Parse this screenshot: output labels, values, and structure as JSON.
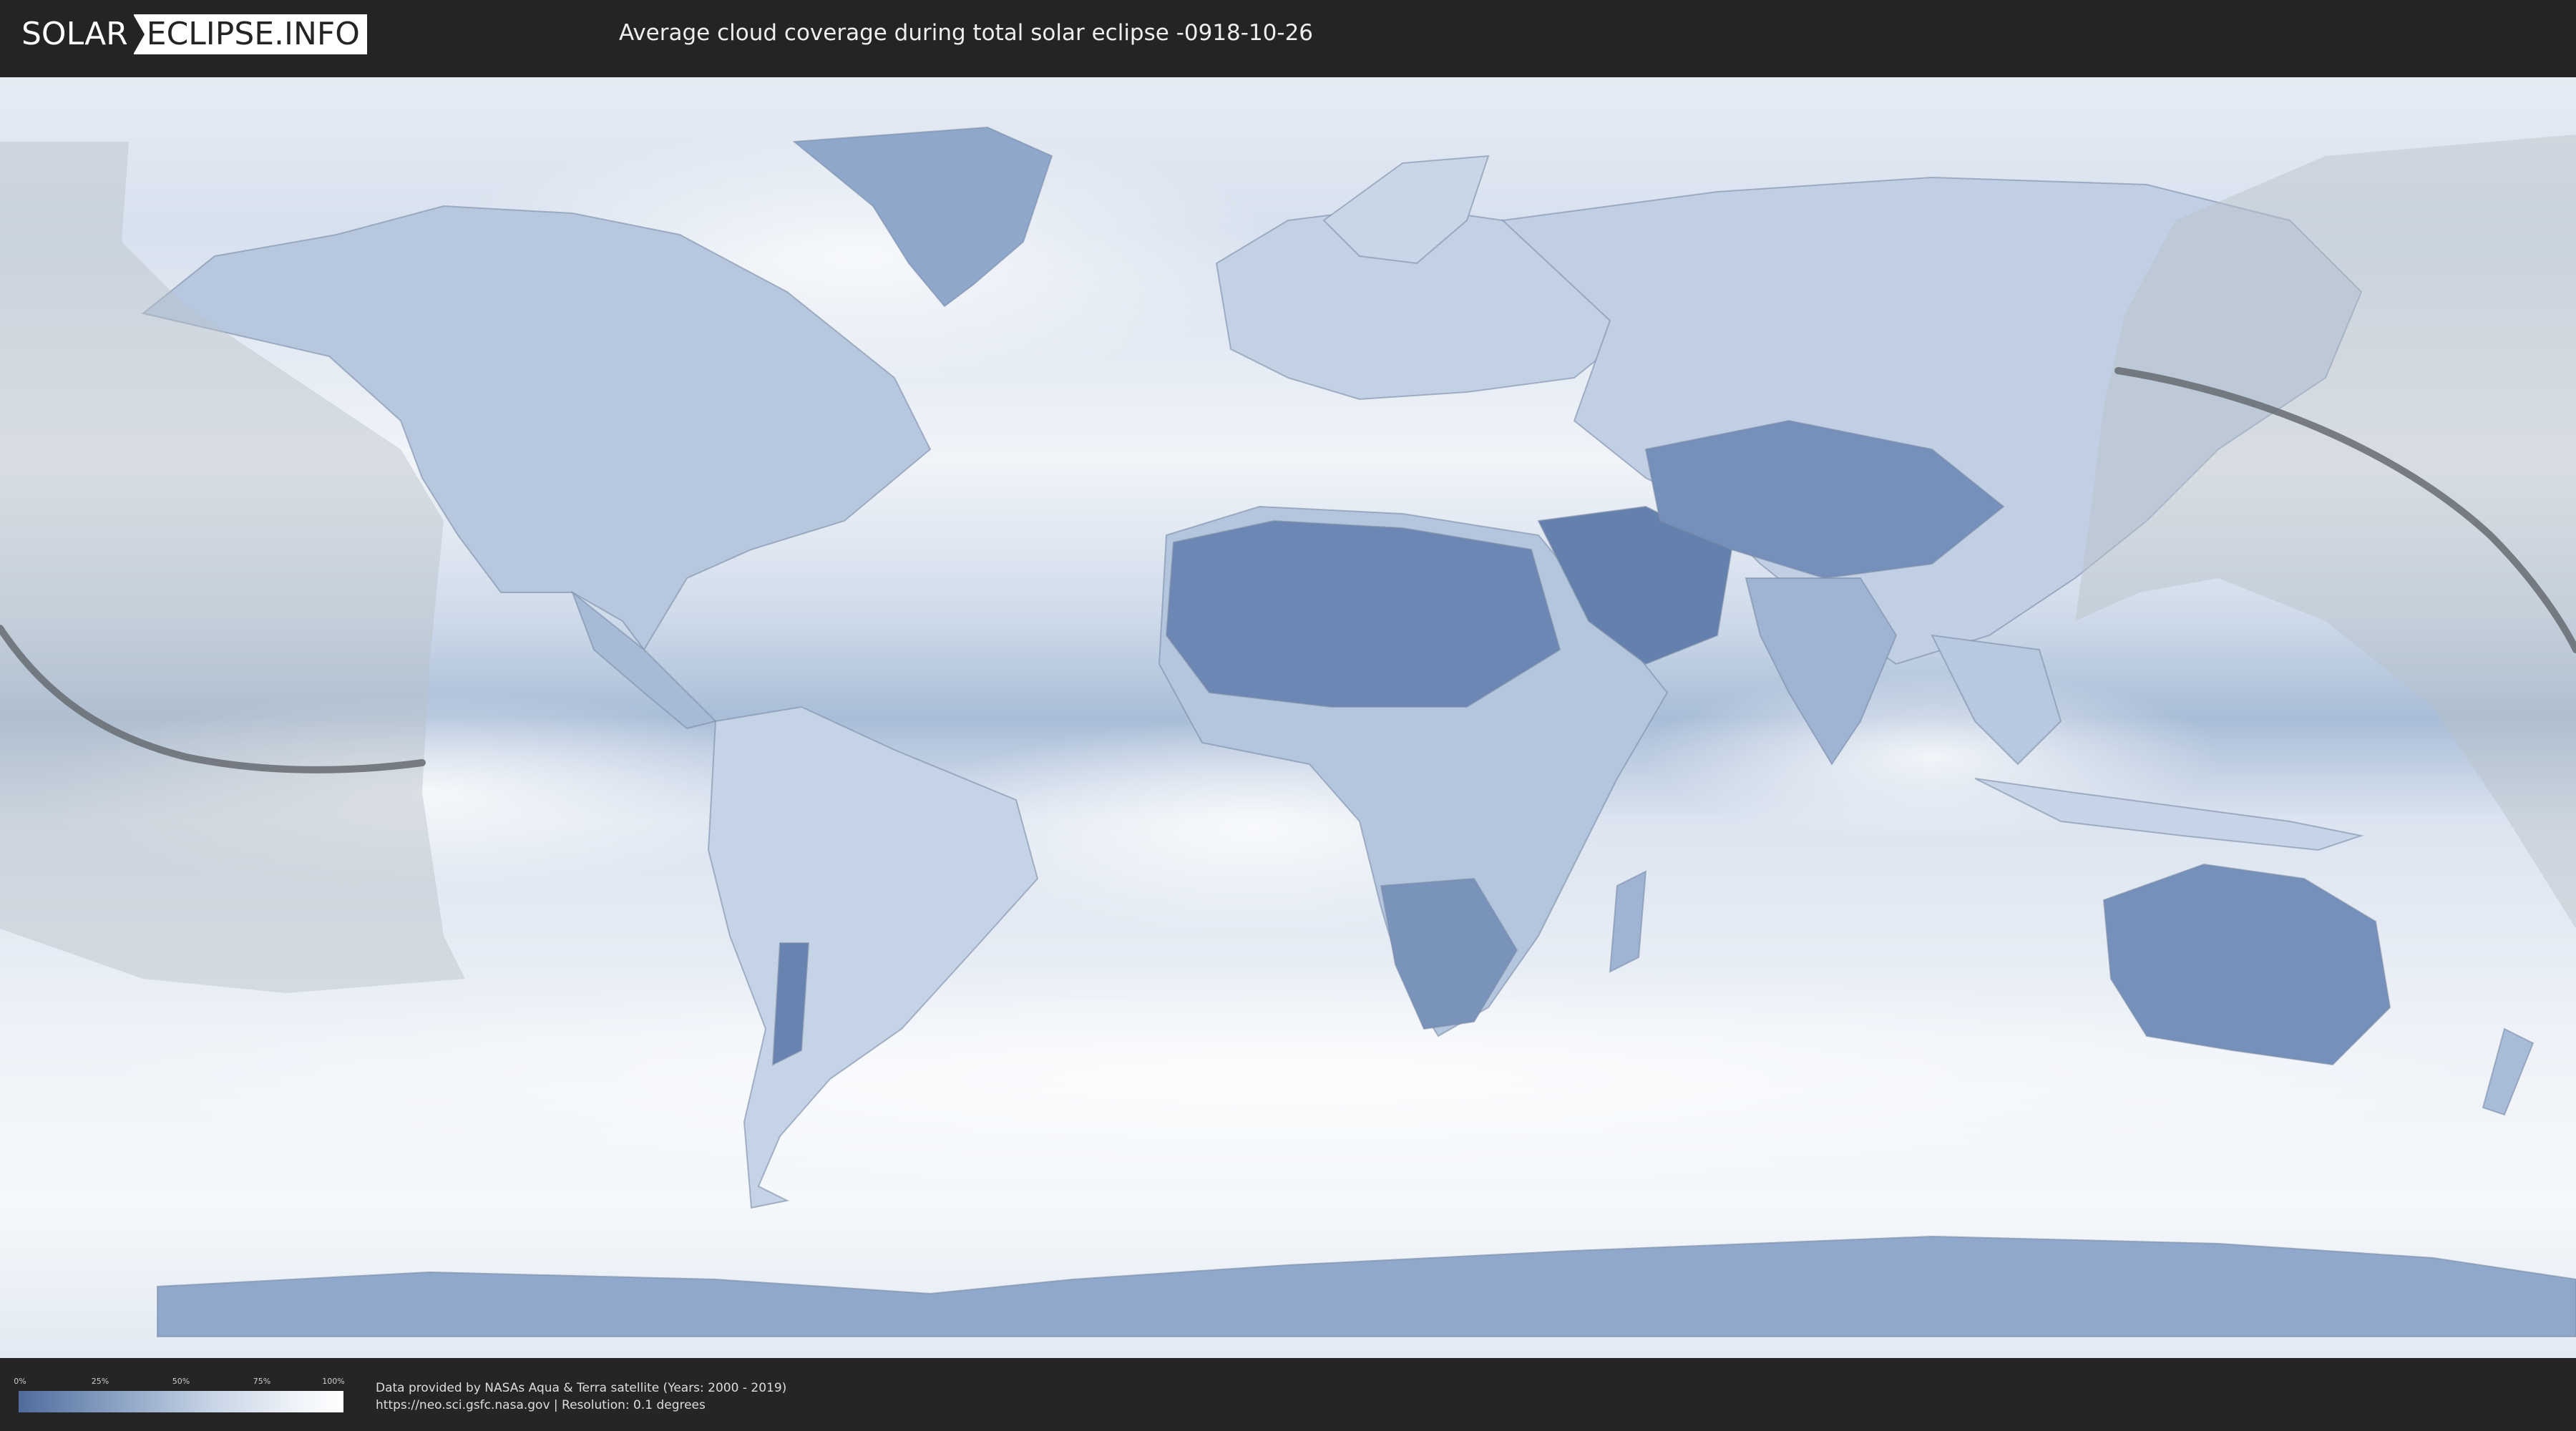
{
  "header": {
    "logo_left": "SOLAR",
    "logo_right": "ECLIPSE.INFO",
    "title": "Average cloud coverage during total solar eclipse -0918-10-26"
  },
  "map": {
    "content": "world cloud coverage map",
    "colors": {
      "clear": "#5a79a8",
      "cloudy": "#f4f7fb",
      "night_overlay": "#b9c0c8",
      "eclipse_path": "#666b72"
    }
  },
  "legend": {
    "ticks": [
      "0%",
      "25%",
      "50%",
      "75%",
      "100%"
    ],
    "colors": [
      "#4f6c9c",
      "#ffffff"
    ]
  },
  "credits": {
    "line1": "Data provided by NASAs Aqua & Terra satellite (Years: 2000 - 2019)",
    "line2": "https://neo.sci.gsfc.nasa.gov | Resolution: 0.1 degrees"
  }
}
